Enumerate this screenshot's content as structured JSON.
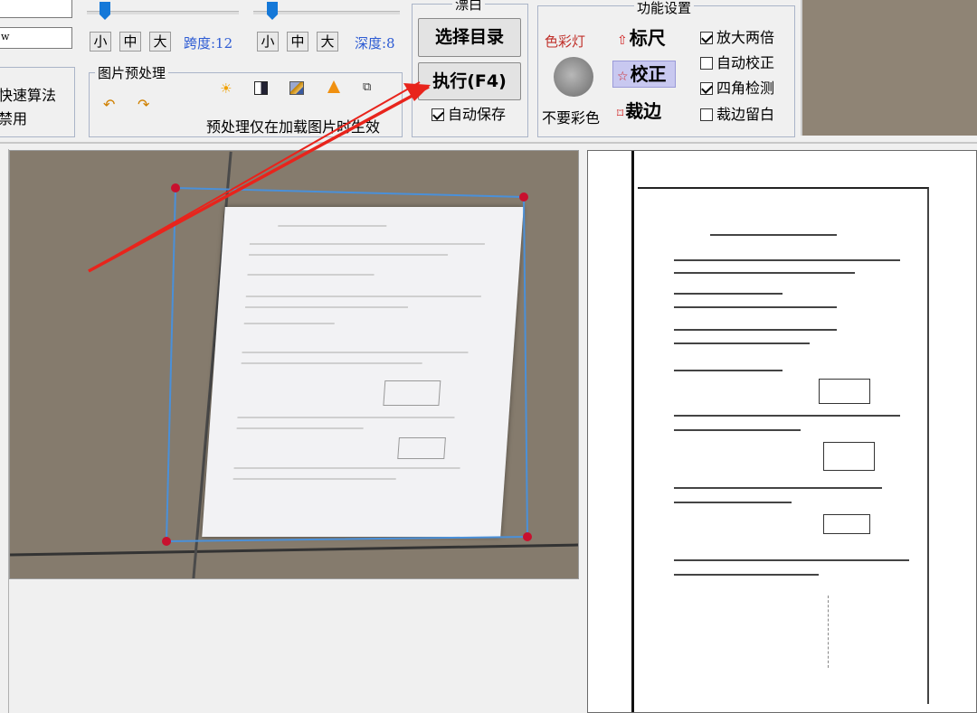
{
  "top": {
    "field1_value": "",
    "field2_value": "w",
    "left_group": {
      "line1": "快速算法",
      "line2": "禁用"
    }
  },
  "span_controls": {
    "small": "小",
    "medium": "中",
    "large": "大",
    "label": "跨度:12"
  },
  "depth_controls": {
    "small": "小",
    "medium": "中",
    "large": "大",
    "label": "深度:8"
  },
  "preprocess": {
    "title": "图片预处理",
    "note": "预处理仅在加载图片时生效",
    "tools": [
      "undo-arrow-icon",
      "redo-arrow-icon",
      "brightness-icon",
      "contrast-icon",
      "image-adjust-icon",
      "sharpen-icon",
      "batch-icon"
    ]
  },
  "whiten": {
    "title": "漂白",
    "select_dir": "选择目录",
    "execute": "执行(F4)",
    "autosave": "自动保存",
    "autosave_checked": true
  },
  "features": {
    "title": "功能设置",
    "color_label": "色彩灯",
    "no_color_label": "不要彩色",
    "ruler": "标尺",
    "correct": "校正",
    "crop": "裁边",
    "options": [
      {
        "label": "放大两倍",
        "checked": true
      },
      {
        "label": "自动校正",
        "checked": false
      },
      {
        "label": "四角检测",
        "checked": true
      },
      {
        "label": "裁边留白",
        "checked": false
      }
    ]
  },
  "colors": {
    "accent_blue": "#2d5bd3",
    "arrow_red": "#e8241c",
    "corner_red": "#c8102e",
    "selection_blue": "#4a90d9"
  }
}
